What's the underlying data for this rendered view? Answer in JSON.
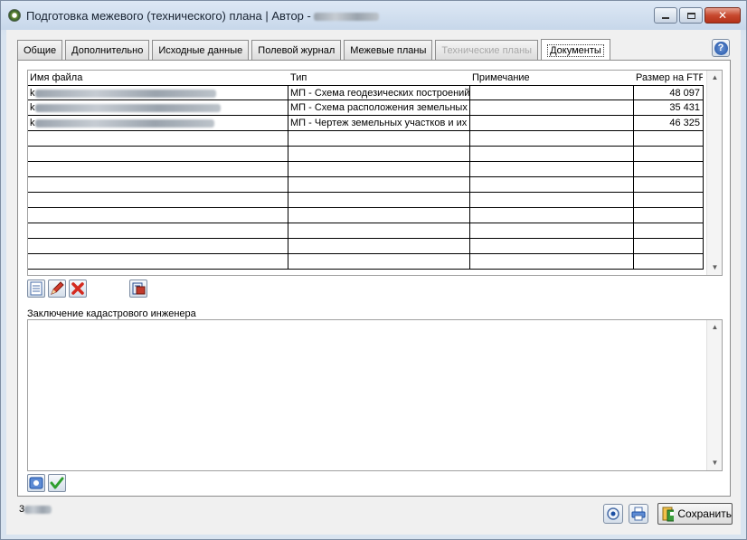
{
  "window": {
    "title": "Подготовка межевого (технического) плана | Автор - ",
    "minimize": "",
    "maximize": "",
    "close": "✕"
  },
  "tabs": [
    {
      "label": "Общие",
      "state": "normal"
    },
    {
      "label": "Дополнительно",
      "state": "normal"
    },
    {
      "label": "Исходные данные",
      "state": "normal"
    },
    {
      "label": "Полевой журнал",
      "state": "normal"
    },
    {
      "label": "Межевые планы",
      "state": "normal"
    },
    {
      "label": "Технические планы",
      "state": "disabled"
    },
    {
      "label": "Документы",
      "state": "active"
    }
  ],
  "help_label": "?",
  "documents_grid": {
    "columns": [
      "Имя файла",
      "Тип",
      "Примечание",
      "Размер на FTP"
    ],
    "rows": [
      {
        "file_name": "k",
        "type": "МП - Схема геодезических построений",
        "note": "",
        "size": "48 097"
      },
      {
        "file_name": "k",
        "type": "МП - Схема расположения земельных",
        "note": "",
        "size": "35 431"
      },
      {
        "file_name": "k",
        "type": "МП - Чертеж земельных участков и их",
        "note": "",
        "size": "46 325"
      }
    ],
    "empty_rows": 9
  },
  "toolbar_icons": [
    "document-icon",
    "pencil-icon",
    "delete-icon",
    "export-icon"
  ],
  "conclusion": {
    "label": "Заключение кадастрового инженера",
    "text": ""
  },
  "footer": {
    "status_text": "3",
    "save_label": "Сохранить"
  },
  "colors": {
    "accent": "#1c4fa3",
    "close_button": "#c7482e",
    "delete_red": "#d42a1f",
    "check_green": "#2e9e2e"
  }
}
